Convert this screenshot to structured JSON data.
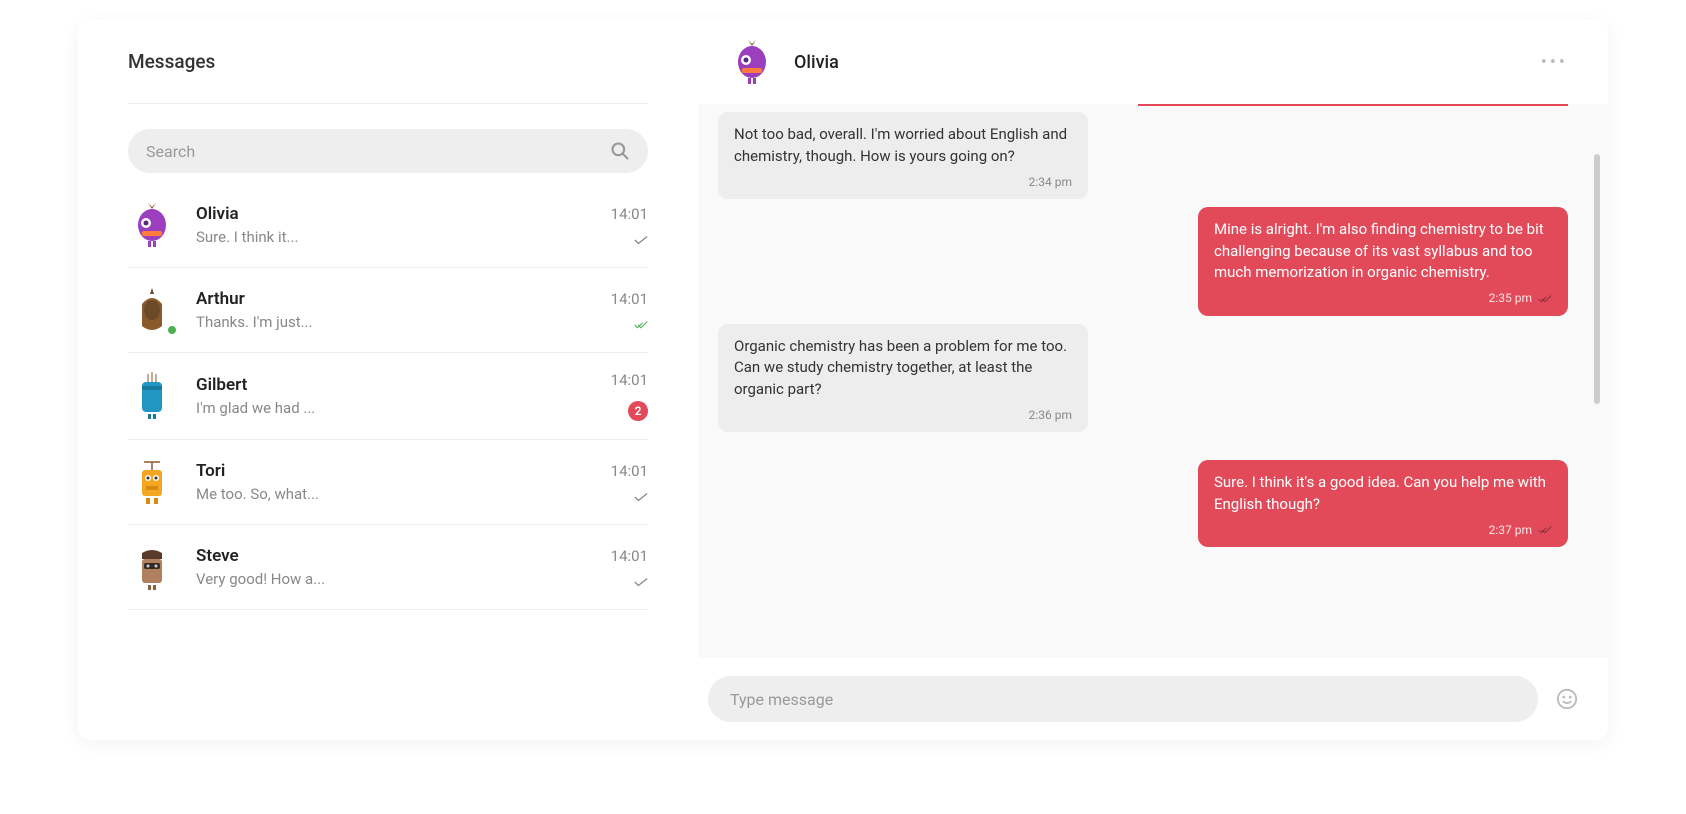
{
  "sidebar": {
    "title": "Messages",
    "search_placeholder": "Search"
  },
  "contacts": [
    {
      "name": "Olivia",
      "preview": "Sure. I think it...",
      "time": "14:01",
      "status": "check",
      "avatar": "olivia"
    },
    {
      "name": "Arthur",
      "preview": "Thanks. I'm just...",
      "time": "14:01",
      "status": "dblcheck",
      "online": true,
      "avatar": "arthur"
    },
    {
      "name": "Gilbert",
      "preview": "I'm glad we had ...",
      "time": "14:01",
      "badge": "2",
      "avatar": "gilbert"
    },
    {
      "name": "Tori",
      "preview": "Me too. So, what...",
      "time": "14:01",
      "status": "check",
      "avatar": "tori"
    },
    {
      "name": "Steve",
      "preview": "Very good! How a...",
      "time": "14:01",
      "status": "check",
      "avatar": "steve"
    }
  ],
  "chat": {
    "header_name": "Olivia",
    "messages": [
      {
        "dir": "in",
        "text": "Not too bad, overall. I'm worried about English and chemistry, though. How is yours going on?",
        "time": "2:34 pm"
      },
      {
        "dir": "out",
        "text": "Mine is alright. I'm also finding chemistry to be bit challenging because of its vast syllabus and too much memorization in organic chemistry.",
        "time": "2:35 pm"
      },
      {
        "dir": "in",
        "text": "Organic chemistry has been a problem for me too. Can we study chemistry together, at least the organic part?",
        "time": "2:36 pm"
      },
      {
        "dir": "out",
        "text": "Sure. I think it's a good idea. Can you help me with English though?",
        "time": "2:37 pm"
      }
    ],
    "input_placeholder": "Type message"
  },
  "colors": {
    "accent": "#e24a5a",
    "bubble_in": "#ededed",
    "bubble_bg": "#f9f9f9"
  }
}
